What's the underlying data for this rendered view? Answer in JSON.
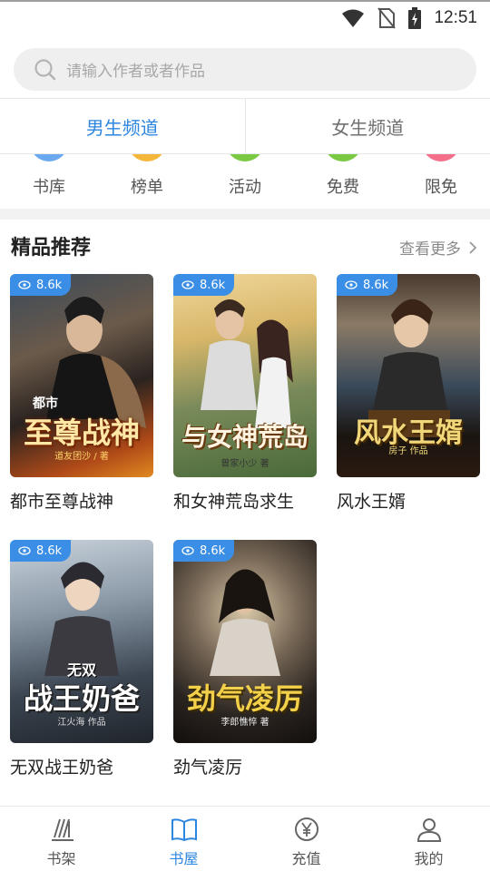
{
  "status": {
    "time": "12:51"
  },
  "search": {
    "placeholder": "请输入作者或者作品"
  },
  "tabs": [
    {
      "label": "男生频道"
    },
    {
      "label": "女生频道"
    }
  ],
  "categories": [
    {
      "label": "书库",
      "color": "#6aa8f0"
    },
    {
      "label": "榜单",
      "color": "#f4b73c"
    },
    {
      "label": "活动",
      "color": "#7ac943"
    },
    {
      "label": "免费",
      "color": "#7ac943"
    },
    {
      "label": "限免",
      "color": "#f4708a"
    }
  ],
  "section": {
    "title": "精品推荐",
    "more": "查看更多"
  },
  "books": [
    {
      "title": "都市至尊战神",
      "views": "8.6k",
      "cover_text": "至尊战神",
      "cover_top": "都市",
      "cover_author": "道友团沙 / 著"
    },
    {
      "title": "和女神荒岛求生",
      "views": "8.6k",
      "cover_text": "与女神荒岛",
      "cover_top": "",
      "cover_author": "曾家小少 著"
    },
    {
      "title": "风水王婿",
      "views": "8.6k",
      "cover_text": "风水王婿",
      "cover_top": "",
      "cover_author": "房子 作品"
    },
    {
      "title": "无双战王奶爸",
      "views": "8.6k",
      "cover_text": "战王奶爸",
      "cover_top": "无双",
      "cover_author": "江火海 作品"
    },
    {
      "title": "劲气凌厉",
      "views": "8.6k",
      "cover_text": "劲气凌厉",
      "cover_top": "",
      "cover_author": "李郎憔悴 著"
    }
  ],
  "bottom_nav": [
    {
      "label": "书架",
      "icon": "bookshelf-icon"
    },
    {
      "label": "书屋",
      "icon": "open-book-icon"
    },
    {
      "label": "充值",
      "icon": "yen-coin-icon"
    },
    {
      "label": "我的",
      "icon": "person-icon"
    }
  ],
  "colors": {
    "accent": "#2d86e0",
    "badge": "#3b8ee5"
  }
}
